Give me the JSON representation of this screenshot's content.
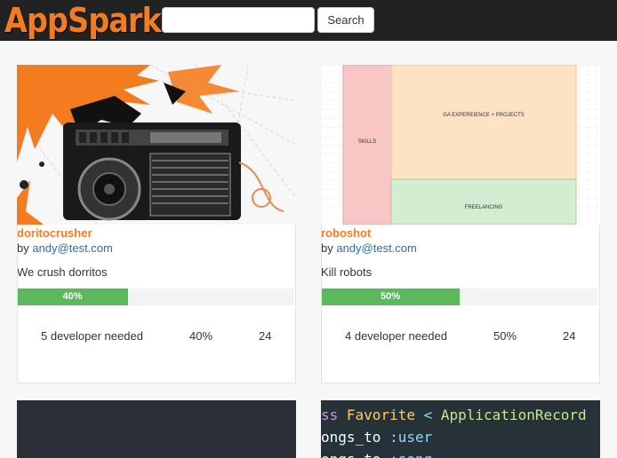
{
  "nav": {
    "brand": "AppSpark",
    "search_placeholder": "",
    "search_button": "Search"
  },
  "cards": [
    {
      "title": "doritocrusher",
      "by_prefix": "by ",
      "author": "andy@test.com",
      "description": "We crush dorritos",
      "progress": 0.4,
      "progress_label": "40%",
      "developers": "5 developer needed",
      "percent": "40%",
      "count": "24"
    },
    {
      "title": "roboshot",
      "by_prefix": "by ",
      "author": "andy@test.com",
      "description": "Kill robots",
      "progress": 0.5,
      "progress_label": "50%",
      "developers": "4 developer needed",
      "percent": "50%",
      "count": "24",
      "wireframe": {
        "skills": "SKILLS",
        "experience": "GA EXPEREIENCE + PROJECTS",
        "freelancing": "FREELANCING"
      }
    }
  ],
  "code_lines": [
    {
      "kw": "ss ",
      "cls": "Favorite",
      "op": " < ",
      "base": "ApplicationRecord"
    },
    {
      "kw": "ongs_to ",
      "sym": ":user"
    },
    {
      "kw": "ongs_to ",
      "sym": ":song"
    }
  ],
  "colors": {
    "accent": "#f47c20",
    "progress": "#5cb85c",
    "link": "#2a6db0",
    "navbar": "#222222"
  }
}
